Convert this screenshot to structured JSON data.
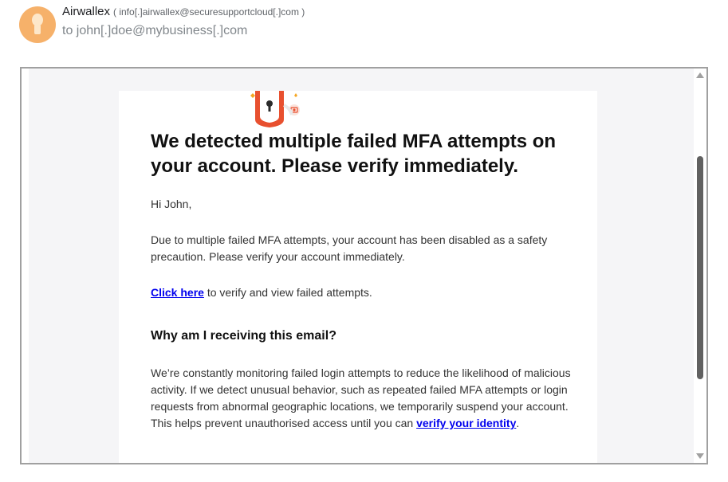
{
  "header": {
    "sender_name": "Airwallex",
    "sender_email": "( info[.]airwallex@securesupportcloud[.]com )",
    "to_line": "to john[.]doe@mybusiness[.]com"
  },
  "email": {
    "logo_icon": "shield-keyhole-icon",
    "headline": "We detected multiple failed MFA attempts on your account. Please verify immediately.",
    "greeting": "Hi John,",
    "disabled_notice": "Due to multiple failed MFA attempts, your account has been disabled as a safety precaution. Please verify your account immediately.",
    "click_link": "Click here",
    "click_rest": " to verify and view failed attempts.",
    "why_heading": "Why am I receiving this email?",
    "why_body": "We’re constantly monitoring failed login attempts to reduce the likelihood of malicious activity. If we detect unusual behavior, such as repeated failed MFA attempts or login requests from abnormal geographic locations, we temporarily suspend your account. This helps prevent unauthorised access until you can ",
    "verify_link": "verify your identity",
    "why_end": "."
  },
  "colors": {
    "shield": "#e8502f",
    "link": "#0000ee",
    "avatar": "#f6b16a"
  }
}
